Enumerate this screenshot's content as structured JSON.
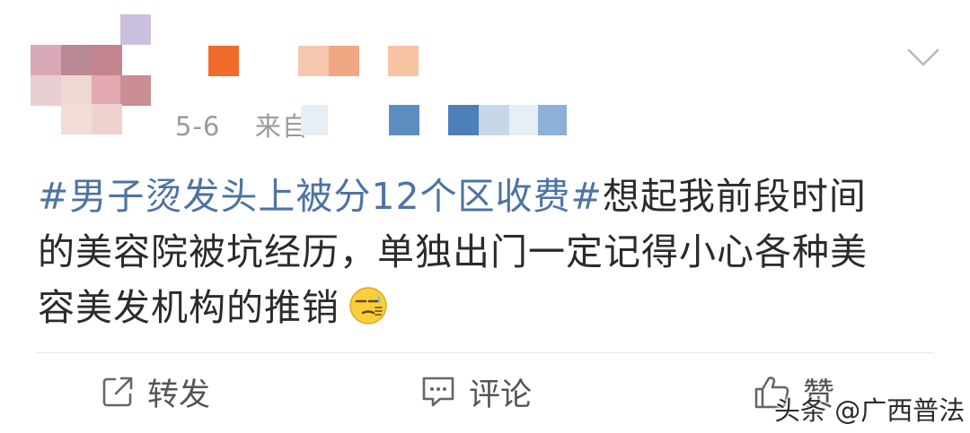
{
  "post": {
    "timestamp": "5-6",
    "source_prefix": "来自",
    "topic": "#男子烫发头上被分12个区收费#",
    "text_line1": "想起我前段时间",
    "text_line2": "的美容院被坑经历，单独出门一定记得小心各种美",
    "text_line3": "容美发机构的推销"
  },
  "icons": {
    "menu": "chevron-down-icon",
    "forward": "share-arrow-icon",
    "comment": "comment-bubble-icon",
    "like": "thumbs-up-icon",
    "emoji": "sweat-smile-emoji"
  },
  "actions": {
    "forward_label": "转发",
    "comment_label": "评论",
    "like_label": "赞"
  },
  "watermark": {
    "text": "头条 @广西普法"
  },
  "colors": {
    "topic": "#4d73a3",
    "body_text": "#2b2b2b",
    "meta_text": "#9a9a9a"
  }
}
